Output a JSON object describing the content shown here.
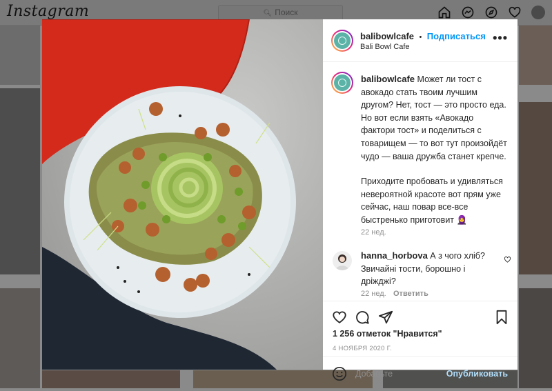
{
  "topbar": {
    "logo": "Instagram",
    "search_placeholder": "Поиск"
  },
  "post": {
    "username": "balibowlcafe",
    "follow_label": "Подписаться",
    "separator": "•",
    "subtitle": "Bali Bowl Cafe",
    "more_label": "•••",
    "caption_user": "balibowlcafe",
    "caption_p1": "Может ли тост с авокадо стать твоим лучшим другом? Нет, тост — это просто еда. Но вот если взять «Авокадо фактори тост» и поделиться с товарищем — то вот тут произойдёт чудо — ваша дружба станет крепче.",
    "caption_p2": "Приходите пробовать и удивляться невероятной красоте вот прям уже сейчас, наш повар все-все быстренько приготовит 🧕",
    "caption_time": "22 нед.",
    "comment": {
      "user": "hanna_horbova",
      "text": "А з чого хліб? Звичайні тости, борошно і дріжджі?",
      "time": "22 нед.",
      "reply_label": "Ответить"
    },
    "likes": "1 256 отметок \"Нравится\"",
    "date": "4 НОЯБРЯ 2020 Г.",
    "add_comment_placeholder": "Добавьте",
    "publish_label": "Опубликовать"
  },
  "colors": {
    "link_blue": "#0095f6",
    "publish_disabled": "#b2dffc",
    "text": "#262626",
    "muted": "#8e8e8e"
  }
}
